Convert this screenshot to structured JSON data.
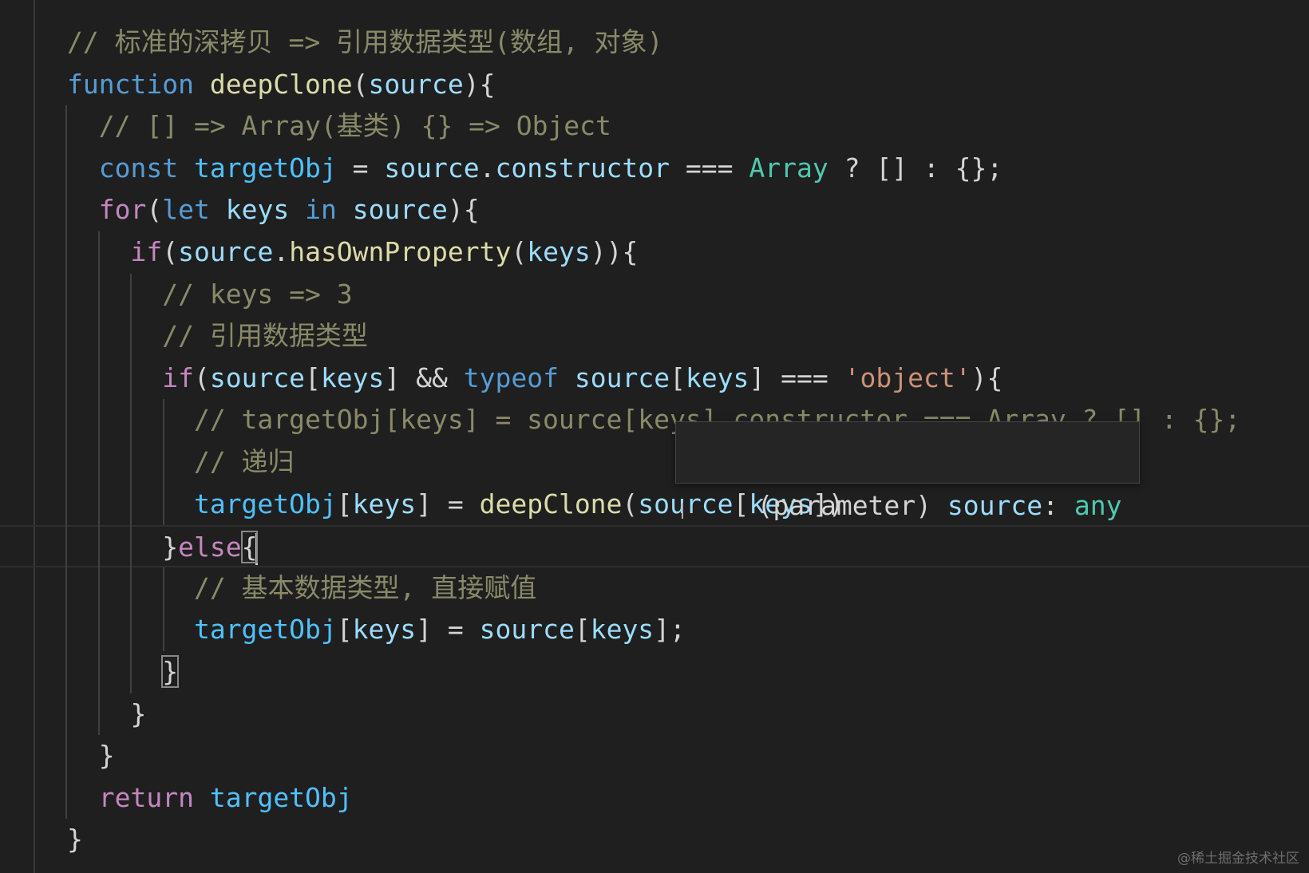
{
  "editor": {
    "lines": [
      {
        "indent": "",
        "tokens": [
          {
            "c": "tok-comment dim",
            "t": "// 标准的深拷贝 => 引用数据类型(数组, 对象)"
          }
        ]
      },
      {
        "indent": "",
        "tokens": [
          {
            "c": "tok-kw",
            "t": "function"
          },
          {
            "c": "tok-punc",
            "t": " "
          },
          {
            "c": "tok-fn",
            "t": "deepClone"
          },
          {
            "c": "tok-punc",
            "t": "("
          },
          {
            "c": "tok-var",
            "t": "source"
          },
          {
            "c": "tok-punc",
            "t": "){"
          }
        ]
      },
      {
        "indent": "  ",
        "tokens": [
          {
            "c": "tok-comment dim",
            "t": "// [] => Array(基类) {} => Object"
          }
        ]
      },
      {
        "indent": "  ",
        "tokens": [
          {
            "c": "tok-kw",
            "t": "const"
          },
          {
            "c": "tok-punc",
            "t": " "
          },
          {
            "c": "tok-const",
            "t": "targetObj"
          },
          {
            "c": "tok-punc",
            "t": " = "
          },
          {
            "c": "tok-var",
            "t": "source"
          },
          {
            "c": "tok-punc",
            "t": "."
          },
          {
            "c": "tok-var",
            "t": "constructor"
          },
          {
            "c": "tok-punc",
            "t": " === "
          },
          {
            "c": "tok-type",
            "t": "Array"
          },
          {
            "c": "tok-punc",
            "t": " ? [] : {};"
          }
        ]
      },
      {
        "indent": "  ",
        "tokens": [
          {
            "c": "tok-ctrl",
            "t": "for"
          },
          {
            "c": "tok-punc",
            "t": "("
          },
          {
            "c": "tok-kw",
            "t": "let"
          },
          {
            "c": "tok-punc",
            "t": " "
          },
          {
            "c": "tok-var",
            "t": "keys"
          },
          {
            "c": "tok-punc",
            "t": " "
          },
          {
            "c": "tok-kw",
            "t": "in"
          },
          {
            "c": "tok-punc",
            "t": " "
          },
          {
            "c": "tok-var",
            "t": "source"
          },
          {
            "c": "tok-punc",
            "t": "){"
          }
        ]
      },
      {
        "indent": "    ",
        "tokens": [
          {
            "c": "tok-ctrl",
            "t": "if"
          },
          {
            "c": "tok-punc",
            "t": "("
          },
          {
            "c": "tok-var",
            "t": "source"
          },
          {
            "c": "tok-punc",
            "t": "."
          },
          {
            "c": "tok-fn",
            "t": "hasOwnProperty"
          },
          {
            "c": "tok-punc",
            "t": "("
          },
          {
            "c": "tok-var",
            "t": "keys"
          },
          {
            "c": "tok-punc",
            "t": ")){"
          }
        ]
      },
      {
        "indent": "      ",
        "tokens": [
          {
            "c": "tok-comment dim",
            "t": "// keys => 3"
          }
        ]
      },
      {
        "indent": "      ",
        "tokens": [
          {
            "c": "tok-comment dim",
            "t": "// 引用数据类型"
          }
        ]
      },
      {
        "indent": "      ",
        "tokens": [
          {
            "c": "tok-ctrl",
            "t": "if"
          },
          {
            "c": "tok-punc",
            "t": "("
          },
          {
            "c": "tok-var",
            "t": "source"
          },
          {
            "c": "tok-punc",
            "t": "["
          },
          {
            "c": "tok-var",
            "t": "keys"
          },
          {
            "c": "tok-punc",
            "t": "] && "
          },
          {
            "c": "tok-kw",
            "t": "typeof"
          },
          {
            "c": "tok-punc",
            "t": " "
          },
          {
            "c": "tok-var",
            "t": "source"
          },
          {
            "c": "tok-punc",
            "t": "["
          },
          {
            "c": "tok-var",
            "t": "keys"
          },
          {
            "c": "tok-punc",
            "t": "] === "
          },
          {
            "c": "tok-str",
            "t": "'object'"
          },
          {
            "c": "tok-punc",
            "t": "){"
          }
        ]
      },
      {
        "indent": "        ",
        "tokens": [
          {
            "c": "tok-comment dim",
            "t": "// targetObj[keys] = source[keys].constructor === Array ? [] : {};"
          }
        ]
      },
      {
        "indent": "        ",
        "tokens": [
          {
            "c": "tok-comment dim",
            "t": "// 递归"
          }
        ]
      },
      {
        "indent": "        ",
        "tokens": [
          {
            "c": "tok-const",
            "t": "targetObj"
          },
          {
            "c": "tok-punc",
            "t": "["
          },
          {
            "c": "tok-var",
            "t": "keys"
          },
          {
            "c": "tok-punc",
            "t": "] = "
          },
          {
            "c": "tok-fn",
            "t": "deepClone"
          },
          {
            "c": "tok-punc",
            "t": "("
          },
          {
            "c": "tok-var",
            "t": "source"
          },
          {
            "c": "tok-punc",
            "t": "["
          },
          {
            "c": "tok-var",
            "t": "keys"
          },
          {
            "c": "tok-punc",
            "t": "])"
          }
        ]
      },
      {
        "indent": "      ",
        "current": true,
        "tokens": [
          {
            "c": "tok-punc",
            "t": "}"
          },
          {
            "c": "tok-ctrl",
            "t": "else"
          },
          {
            "c": "tok-punc match-box",
            "t": "{"
          }
        ]
      },
      {
        "indent": "        ",
        "tokens": [
          {
            "c": "tok-comment dim",
            "t": "// 基本数据类型, 直接赋值"
          }
        ]
      },
      {
        "indent": "        ",
        "tokens": [
          {
            "c": "tok-const",
            "t": "targetObj"
          },
          {
            "c": "tok-punc",
            "t": "["
          },
          {
            "c": "tok-var",
            "t": "keys"
          },
          {
            "c": "tok-punc",
            "t": "] = "
          },
          {
            "c": "tok-var",
            "t": "source"
          },
          {
            "c": "tok-punc",
            "t": "["
          },
          {
            "c": "tok-var",
            "t": "keys"
          },
          {
            "c": "tok-punc",
            "t": "];"
          }
        ]
      },
      {
        "indent": "      ",
        "tokens": [
          {
            "c": "tok-punc match-box",
            "t": "}"
          }
        ]
      },
      {
        "indent": "    ",
        "tokens": [
          {
            "c": "tok-punc",
            "t": "}"
          }
        ]
      },
      {
        "indent": "  ",
        "tokens": [
          {
            "c": "tok-punc",
            "t": "}"
          }
        ]
      },
      {
        "indent": "  ",
        "tokens": [
          {
            "c": "tok-ctrl",
            "t": "return"
          },
          {
            "c": "tok-punc",
            "t": " "
          },
          {
            "c": "tok-const",
            "t": "targetObj"
          }
        ]
      },
      {
        "indent": "",
        "tokens": [
          {
            "c": "tok-punc",
            "t": "}"
          }
        ]
      }
    ]
  },
  "hover": {
    "label": "(parameter)",
    "name": "source",
    "sep": ":",
    "type": "any"
  },
  "watermark": "@稀土掘金技术社区"
}
